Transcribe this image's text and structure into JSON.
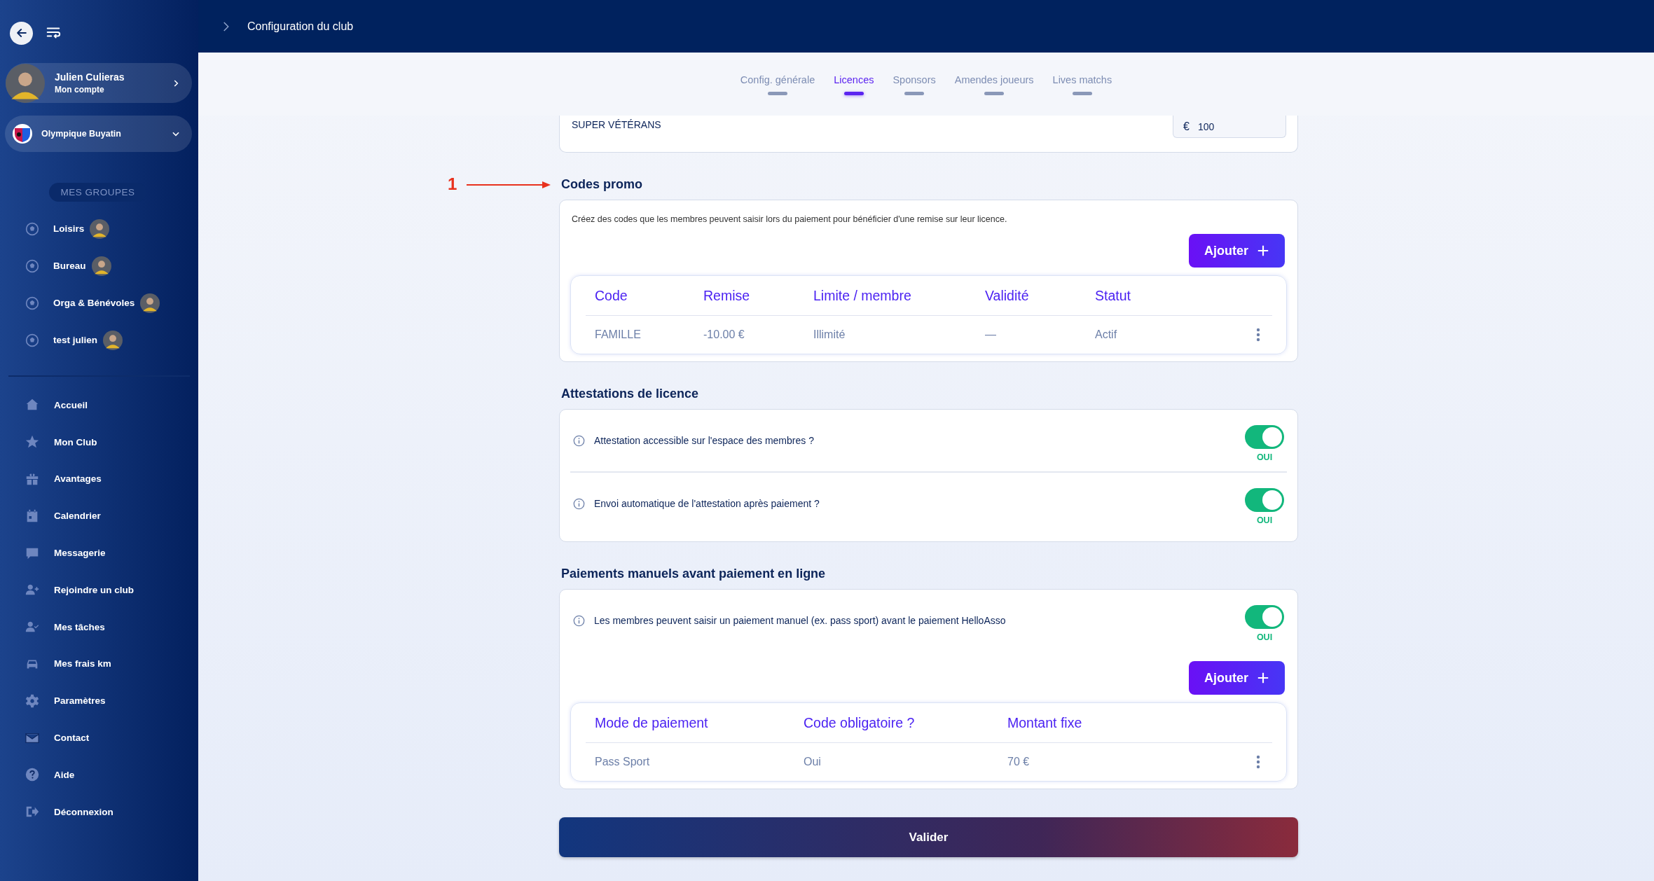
{
  "header": {
    "title": "Configuration du club"
  },
  "sidebar": {
    "user": {
      "name": "Julien Culieras",
      "subtitle": "Mon compte"
    },
    "club": {
      "name": "Olympique Buyatin"
    },
    "groups_label": "MES GROUPES",
    "groups": [
      {
        "label": "Loisirs"
      },
      {
        "label": "Bureau"
      },
      {
        "label": "Orga & Bénévoles"
      },
      {
        "label": "test julien"
      }
    ],
    "nav": [
      {
        "label": "Accueil"
      },
      {
        "label": "Mon Club"
      },
      {
        "label": "Avantages"
      },
      {
        "label": "Calendrier"
      },
      {
        "label": "Messagerie"
      },
      {
        "label": "Rejoindre un club"
      },
      {
        "label": "Mes tâches"
      },
      {
        "label": "Mes frais km"
      },
      {
        "label": "Paramètres"
      },
      {
        "label": "Contact"
      },
      {
        "label": "Aide"
      },
      {
        "label": "Déconnexion"
      }
    ]
  },
  "tabs": [
    {
      "label": "Config. générale",
      "selected": false
    },
    {
      "label": "Licences",
      "selected": true
    },
    {
      "label": "Sponsors",
      "selected": false
    },
    {
      "label": "Amendes joueurs",
      "selected": false
    },
    {
      "label": "Lives matchs",
      "selected": false
    }
  ],
  "top_card": {
    "label": "SUPER VÉTÉRANS",
    "currency": "€",
    "value": "100"
  },
  "annotation": {
    "label": "1"
  },
  "promo": {
    "title": "Codes promo",
    "description": "Créez des codes que les membres peuvent saisir lors du paiement pour bénéficier d'une remise sur leur licence.",
    "add_button": "Ajouter",
    "columns": [
      "Code",
      "Remise",
      "Limite / membre",
      "Validité",
      "Statut"
    ],
    "rows": [
      {
        "cells": [
          "FAMILLE",
          "-10.00 €",
          "Illimité",
          "—",
          "Actif"
        ]
      }
    ]
  },
  "attestations": {
    "title": "Attestations de licence",
    "items": [
      {
        "label": "Attestation accessible sur l'espace des membres ?",
        "on": true,
        "state_label": "OUI"
      },
      {
        "label": "Envoi automatique de l'attestation après paiement ?",
        "on": true,
        "state_label": "OUI"
      }
    ]
  },
  "manual": {
    "title": "Paiements manuels avant paiement en ligne",
    "items": [
      {
        "label": "Les membres peuvent saisir un paiement manuel (ex. pass sport) avant le paiement HelloAsso",
        "on": true,
        "state_label": "OUI"
      }
    ],
    "add_button": "Ajouter",
    "columns": [
      "Mode de paiement",
      "Code obligatoire ?",
      "Montant fixe"
    ],
    "rows": [
      {
        "cells": [
          "Pass Sport",
          "Oui",
          "70 €"
        ]
      }
    ]
  },
  "submit": "Valider"
}
